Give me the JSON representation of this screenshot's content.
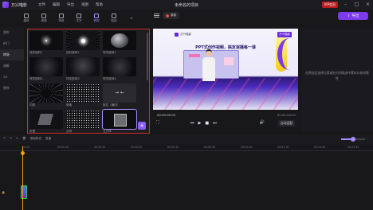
{
  "app": {
    "name": "万兴喵影",
    "doc_title": "未命名的项目",
    "vip_label": "VIP会员"
  },
  "menu": [
    "文件",
    "编辑",
    "导出",
    "视图",
    "帮助"
  ],
  "tooltabs": [
    {
      "label": "媒体",
      "active": false
    },
    {
      "label": "音频",
      "active": false
    },
    {
      "label": "特效",
      "active": false
    },
    {
      "label": "文字",
      "active": false
    },
    {
      "label": "转场",
      "active": true
    },
    {
      "label": "贴纸",
      "active": false
    },
    {
      "label": "≫",
      "active": false
    }
  ],
  "player_header": {
    "record_label": "录制"
  },
  "export_button": "导出",
  "leftnav": [
    {
      "label": "我的",
      "active": false
    },
    {
      "label": "热门",
      "active": false
    },
    {
      "label": "转场",
      "active": true
    },
    {
      "label": "溶解",
      "active": false
    },
    {
      "label": "3D",
      "active": false
    },
    {
      "label": "擦除",
      "active": false
    }
  ],
  "assets": [
    {
      "caption": "炫彩旋转1",
      "style": "t-star",
      "selected": false
    },
    {
      "caption": "炫彩旋转2",
      "style": "t-burst",
      "selected": false
    },
    {
      "caption": "球形旋转1",
      "style": "t-sphere",
      "selected": false
    },
    {
      "caption": "球形旋转2",
      "style": "t-dim",
      "selected": false
    },
    {
      "caption": "球形旋转3",
      "style": "t-dim2",
      "selected": false
    },
    {
      "caption": "球形旋转4",
      "style": "t-dim",
      "selected": false
    },
    {
      "caption": "闪现",
      "style": "t-rays",
      "selected": false
    },
    {
      "caption": "像素",
      "style": "t-dots",
      "selected": false
    },
    {
      "caption": "推拉（横向）",
      "style": "t-doors",
      "selected": false
    },
    {
      "caption": "折叠",
      "style": "t-fold",
      "selected": false
    },
    {
      "caption": "点阵",
      "style": "t-dots",
      "selected": false
    },
    {
      "caption": "立方体",
      "style": "t-box",
      "selected": true
    }
  ],
  "add_button": "+",
  "preview": {
    "brand": "万兴喵影",
    "brand_right": "万兴喵影",
    "headline": "PPT式创作视频，搞定演播每一课"
  },
  "player": {
    "time_current": "00:00:00:00",
    "time_total": "00:00:00:02",
    "fit_label": "自动适配",
    "controls": [
      "⏮",
      "▶",
      "■",
      "⏭"
    ],
    "volume_icon": "🔊",
    "fullscreen_icon": "⛶"
  },
  "right_hint": "在预览区选择元素或在时间线选中素材以修改属性",
  "timeline": {
    "tools": [
      "↶",
      "↷",
      "✂",
      "🗑",
      "添加标记",
      "变速"
    ],
    "ruler": [
      "00:00",
      "00:00:10",
      "00:00:20",
      "00:00:30",
      "00:00:40",
      "00:00:50",
      "00:01:00",
      "00:01:10",
      "00:01:20",
      "00:01:30"
    ]
  },
  "colors": {
    "accent": "#7c3aed",
    "highlight_border": "#d12c2c",
    "playhead": "#f59e0b"
  }
}
